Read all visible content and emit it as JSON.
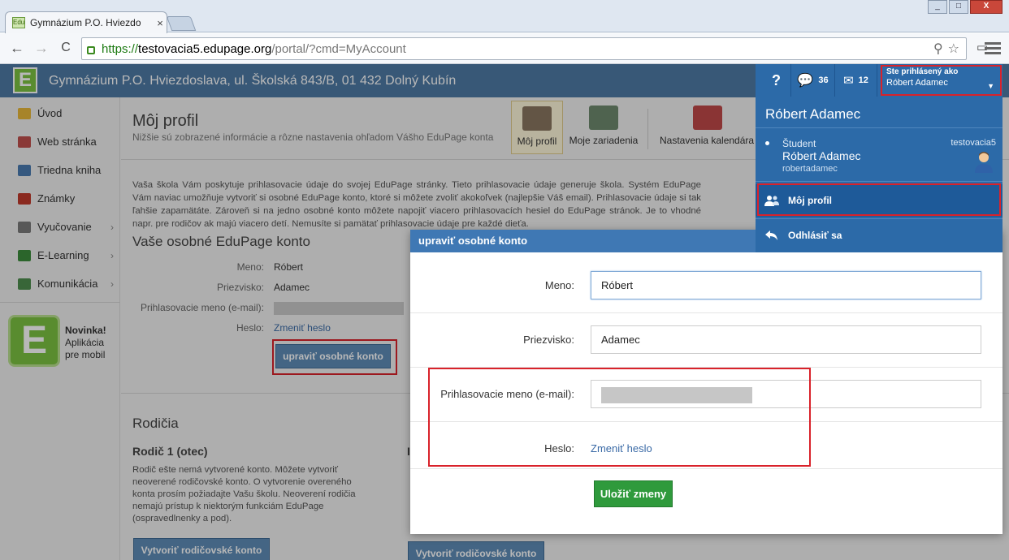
{
  "browser": {
    "tab_title": "Gymnázium P.O. Hviezdo",
    "favicon_text": "Edu",
    "tab_close": "×",
    "url_scheme": "https://",
    "url_host": "testovacia5.edupage.org",
    "url_path": "/portal/?cmd=MyAccount",
    "back": "←",
    "forward": "→",
    "reload": "C",
    "win_min": "_",
    "win_max": "□",
    "win_close": "X"
  },
  "site": {
    "logo": "E",
    "name": "Gymnázium P.O. Hviezdoslava, ul. Školská 843/B, 01 432 Dolný Kubín"
  },
  "sidebar": {
    "items": [
      {
        "label": "Úvod",
        "icon": "star-icon",
        "color": "#e8b73a"
      },
      {
        "label": "Web stránka",
        "icon": "web-icon",
        "color": "#c0504d"
      },
      {
        "label": "Triedna kniha",
        "icon": "book-icon",
        "color": "#4a7ab0"
      },
      {
        "label": "Známky",
        "icon": "grades-icon",
        "color": "#c0392b"
      },
      {
        "label": "Vyučovanie",
        "icon": "teaching-icon",
        "color": "#7a7a7a"
      },
      {
        "label": "E-Learning",
        "icon": "elearning-icon",
        "color": "#3c8c3c"
      },
      {
        "label": "Komunikácia",
        "icon": "communication-icon",
        "color": "#4e8e4e"
      }
    ],
    "arrow": "›",
    "novinka": {
      "logo": "E",
      "line1": "Novinka!",
      "line2": "Aplikácia",
      "line3": "pre mobil"
    }
  },
  "main": {
    "title": "Môj profil",
    "subtitle": "Nižšie sú zobrazené informácie a rôzne nastavenia ohľadom Vášho EduPage konta",
    "toolbar": [
      {
        "label": "Môj profil"
      },
      {
        "label": "Moje zariadenia"
      },
      {
        "label": "Nastavenia kalendára"
      }
    ],
    "intro": "Vaša škola Vám poskytuje prihlasovacie údaje do svojej EduPage stránky. Tieto prihlasovacie údaje generuje škola. Systém EduPage Vám naviac umožňuje vytvoriť si osobné EduPage konto, ktoré si môžete zvoliť akokoľvek (najlepšie Váš email). Prihlasovacie údaje si tak ľahšie zapamätáte. Zároveň si na jedno osobné konto môžete napojiť viacero prihlasovacích hesiel do EduPage stránok. Je to vhodné napr. pre rodičov ak majú viacero detí. Nemusíte si pamätať prihlasovacie údaje pre každé dieťa.",
    "section_title": "Vaše osobné EduPage konto",
    "fields": {
      "meno_label": "Meno:",
      "meno_value": "Róbert",
      "priezvisko_label": "Priezvisko:",
      "priezvisko_value": "Adamec",
      "login_label": "Prihlasovacie meno (e-mail):",
      "heslo_label": "Heslo:",
      "heslo_link": "Zmeniť heslo"
    },
    "edit_button": "upraviť osobné konto",
    "parents_title": "Rodičia",
    "parent1_title": "Rodič 1 (otec)",
    "parent1_text": "Rodič ešte nemá vytvorené konto. Môžete vytvoriť neoverené rodičovské konto. O vytvorenie overeného konta prosím požiadajte Vašu školu. Neoverení rodičia nemajú prístup k niektorým funkciám EduPage (ospravedlnenky a pod).",
    "parent2_initial": "I",
    "create_parent_button": "Vytvoriť rodičovské konto"
  },
  "modal": {
    "title": "upraviť osobné konto",
    "meno_label": "Meno:",
    "meno_value": "Róbert",
    "priezvisko_label": "Priezvisko:",
    "priezvisko_value": "Adamec",
    "login_label": "Prihlasovacie meno (e-mail):",
    "heslo_label": "Heslo:",
    "heslo_link": "Zmeniť heslo",
    "save_button": "Uložiť zmeny"
  },
  "userbar": {
    "help": "?",
    "messages_count": "36",
    "mail_count": "12",
    "logged_as": "Ste prihlásený ako",
    "user": "Róbert Adamec",
    "caret": "▼"
  },
  "user_dropdown": {
    "name": "Róbert Adamec",
    "role": "Študent",
    "account": "testovacia5",
    "display_name": "Róbert Adamec",
    "login": "robertadamec",
    "my_profile": "Môj profil",
    "logout": "Odhlásiť sa"
  },
  "colors": {
    "header_blue": "#4e7aa5",
    "accent_blue": "#2c6aa8",
    "save_green": "#2f9a3c",
    "highlight_red": "#d9222a"
  }
}
